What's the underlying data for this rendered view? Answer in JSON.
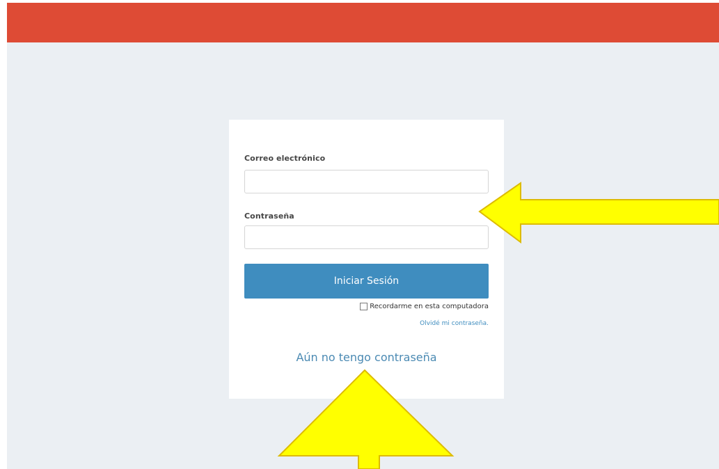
{
  "colors": {
    "top_bar": "#de4b35",
    "background": "#ebeff3",
    "button": "#3f8dbf",
    "link": "#3f8dbf",
    "annotation_fill": "#ffff00",
    "annotation_stroke": "#ddbb00"
  },
  "login": {
    "email_label": "Correo electrónico",
    "email_value": "",
    "password_label": "Contraseña",
    "password_value": "",
    "submit_label": "Iniciar Sesión",
    "remember_label": "Recordarme en esta computadora",
    "remember_checked": false,
    "forgot_link": "Olvidé mi contraseña.",
    "no_password_link": "Aún no tengo contraseña"
  },
  "annotations": [
    {
      "type": "arrow",
      "direction": "left",
      "icon": "yellow-arrow-left-icon"
    },
    {
      "type": "arrow",
      "direction": "up",
      "icon": "yellow-arrow-up-icon"
    }
  ]
}
